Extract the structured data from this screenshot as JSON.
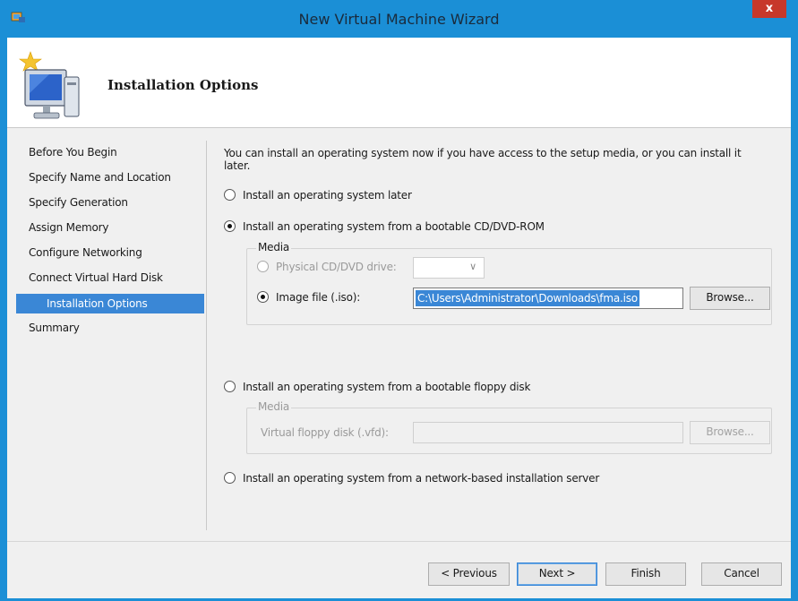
{
  "window": {
    "title": "New Virtual Machine Wizard",
    "close_glyph": "x"
  },
  "header": {
    "title": "Installation Options",
    "icon": "wizard-computer-star-icon"
  },
  "nav": {
    "items": [
      {
        "label": "Before You Begin",
        "selected": false
      },
      {
        "label": "Specify Name and Location",
        "selected": false
      },
      {
        "label": "Specify Generation",
        "selected": false
      },
      {
        "label": "Assign Memory",
        "selected": false
      },
      {
        "label": "Configure Networking",
        "selected": false
      },
      {
        "label": "Connect Virtual Hard Disk",
        "selected": false
      },
      {
        "label": "Installation Options",
        "selected": true
      },
      {
        "label": "Summary",
        "selected": false
      }
    ]
  },
  "content": {
    "intro": "You can install an operating system now if you have access to the setup media, or you can install it later.",
    "option_later": "Install an operating system later",
    "option_cd": "Install an operating system from a bootable CD/DVD-ROM",
    "cd_media": {
      "legend": "Media",
      "physical_label": "Physical CD/DVD drive:",
      "physical_value": "",
      "image_label": "Image file (.iso):",
      "image_value": "C:\\Users\\Administrator\\Downloads\\fma.iso",
      "browse": "Browse..."
    },
    "option_floppy": "Install an operating system from a bootable floppy disk",
    "floppy_media": {
      "legend": "Media",
      "vfd_label": "Virtual floppy disk (.vfd):",
      "vfd_value": "",
      "browse": "Browse..."
    },
    "option_network": "Install an operating system from a network-based installation server"
  },
  "footer": {
    "previous": "< Previous",
    "next": "Next >",
    "finish": "Finish",
    "cancel": "Cancel"
  },
  "colors": {
    "accent": "#3a87d6",
    "titlebar": "#1b8fd6",
    "close": "#c7382a"
  }
}
